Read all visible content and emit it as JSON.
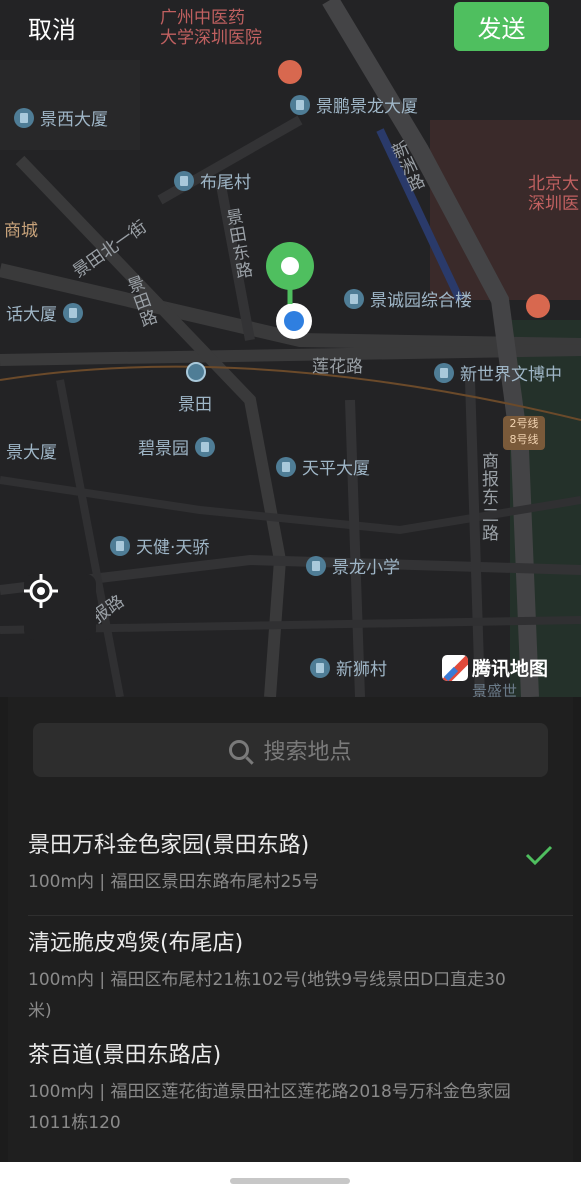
{
  "header": {
    "cancel_label": "取消",
    "send_label": "发送"
  },
  "map": {
    "pois": [
      "景西大厦",
      "景鹏景龙大厦",
      "布尾村",
      "景诚园综合楼",
      "新世界文博中",
      "碧景园",
      "天平大厦",
      "天健·天骄",
      "景龙小学",
      "新狮村",
      "景田",
      "景大厦",
      "话大厦",
      "商城"
    ],
    "roads": [
      "景田北一街",
      "景田东路",
      "景田路",
      "莲花路",
      "新洲路",
      "商报东二路",
      "报路"
    ],
    "hospital": [
      "广州中医药",
      "大学深圳医院"
    ],
    "hospital_right": [
      "北京大",
      "深圳医"
    ],
    "metro_badge": [
      "2号线",
      "8号线"
    ],
    "attribution": "腾讯地图",
    "attribution_partial": "景盛世"
  },
  "search": {
    "placeholder": "搜索地点"
  },
  "results": [
    {
      "title": "景田万科金色家园(景田东路)",
      "subtitle": "100m内 | 福田区景田东路布尾村25号",
      "selected": true
    },
    {
      "title": "清远脆皮鸡煲(布尾店)",
      "subtitle": "100m内 | 福田区布尾村21栋102号(地铁9号线景田D口直走30米)",
      "selected": false
    },
    {
      "title": "茶百道(景田东路店)",
      "subtitle": "100m内 | 福田区莲花街道景田社区莲花路2018号万科金色家园1011栋120",
      "selected": false
    }
  ],
  "colors": {
    "accent": "#4fbf5f",
    "map_bg": "#232325",
    "sheet_bg": "#1f1f1f",
    "label": "#9fb6c7"
  }
}
